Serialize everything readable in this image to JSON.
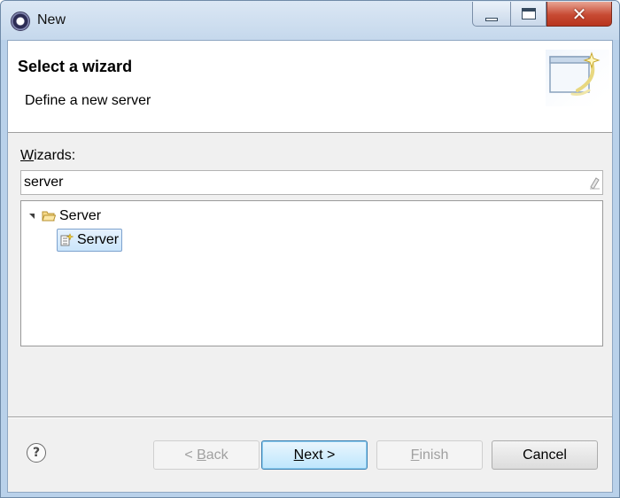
{
  "window": {
    "title": "New"
  },
  "header": {
    "title": "Select a wizard",
    "description": "Define a new server"
  },
  "wizards": {
    "label_mnemonic": "W",
    "label_rest": "izards:",
    "filter_value": "server",
    "tree": [
      {
        "label": "Server",
        "expanded": true,
        "children": [
          {
            "label": "Server",
            "selected": true
          }
        ]
      }
    ]
  },
  "buttons": {
    "back_prefix": "< ",
    "back_mnemonic": "B",
    "back_rest": "ack",
    "next_mnemonic": "N",
    "next_rest": "ext >",
    "finish_mnemonic": "F",
    "finish_rest": "inish",
    "cancel": "Cancel",
    "help_glyph": "?"
  },
  "icons": {
    "app": "eclipse-icon",
    "minimize": "minimize-icon",
    "maximize": "maximize-icon",
    "close": "close-icon",
    "banner": "new-wizard-icon",
    "clear": "clear-filter-icon",
    "folder": "folder-open-icon",
    "server": "server-wizard-icon",
    "help": "help-icon"
  },
  "colors": {
    "accent": "#3c7fb1",
    "selection": "#cbe5fb",
    "close_button": "#c74a33"
  }
}
